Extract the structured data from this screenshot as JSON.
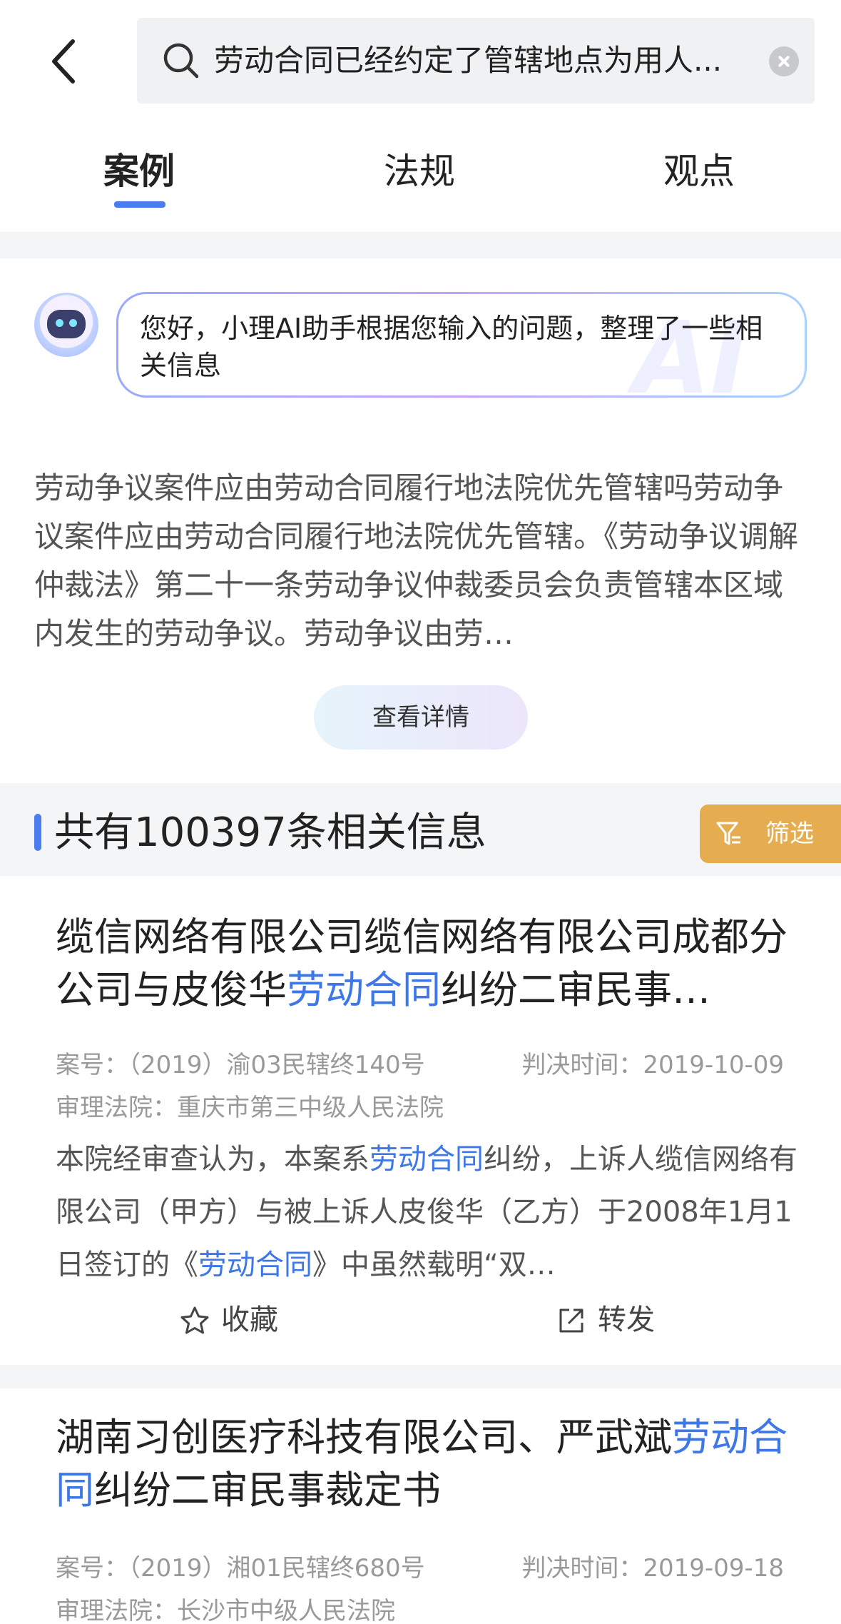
{
  "search": {
    "query": "劳动合同已经约定了管辖地点为用人..."
  },
  "tabs": [
    {
      "label": "案例"
    },
    {
      "label": "法规"
    },
    {
      "label": "观点"
    }
  ],
  "ai": {
    "greeting": "您好，小理AI助手根据您输入的问题，整理了一些相关信息",
    "watermark": "AI",
    "summary": "劳动争议案件应由劳动合同履行地法院优先管辖吗劳动争议案件应由劳动合同履行地法院优先管辖。《劳动争议调解仲裁法》第二十一条劳动争议仲裁委员会负责管辖本区域内发生的劳动争议。劳动争议由劳…",
    "detail_button": "查看详情"
  },
  "results": {
    "count_text": "共有100397条相关信息",
    "filter_label": "筛选"
  },
  "cards": [
    {
      "title_before": "缆信网络有限公司缆信网络有限公司成都分公司与皮俊华",
      "title_highlight": "劳动合同",
      "title_after": "纠纷二审民事…",
      "case_no": "案号：（2019）渝03民辖终140号",
      "date": "判决时间：2019-10-09",
      "court": "审理法院：重庆市第三中级人民法院",
      "excerpt_1": "本院经审查认为，本案系",
      "excerpt_hl_1": "劳动合同",
      "excerpt_2": "纠纷，上诉人缆信网络有限公司（甲方）与被上诉人皮俊华（乙方）于2008年1月1日签订的《",
      "excerpt_hl_2": "劳动合同",
      "excerpt_3": "》中虽然载明“双…",
      "favorite_label": "收藏",
      "forward_label": "转发"
    },
    {
      "title_before": "湖南习创医疗科技有限公司、严武斌",
      "title_highlight": "劳动合同",
      "title_after": "纠纷二审民事裁定书",
      "case_no": "案号：（2019）湘01民辖终680号",
      "date": "判决时间：2019-09-18",
      "court": "审理法院：长沙市中级人民法院"
    }
  ],
  "colors": {
    "accent": "#4a7cf0",
    "highlight": "#3e78e8",
    "filter_bg": "#e5ad50"
  }
}
